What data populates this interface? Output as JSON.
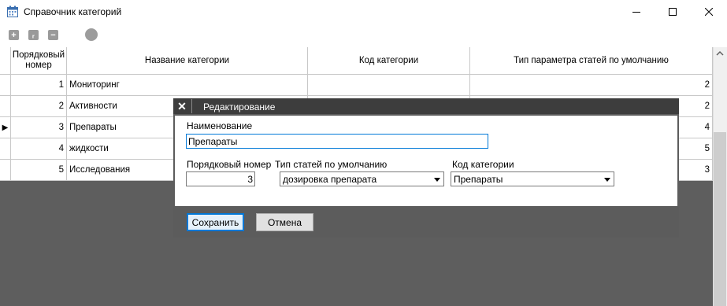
{
  "window": {
    "title": "Справочник категорий",
    "icon": "calendar-grid-icon",
    "minimize_glyph": "—",
    "maximize_glyph": "☐",
    "close_glyph": "✕"
  },
  "toolbar": {
    "add_glyph": "+",
    "edit_glyph": "ᵣ",
    "remove_glyph": "−"
  },
  "table": {
    "headers": [
      "Порядковый номер",
      "Название категории",
      "Код категории",
      "Тип параметра статей по умолчанию"
    ],
    "rows": [
      {
        "num": "1",
        "name": "Мониторинг",
        "code": "",
        "type": "2"
      },
      {
        "num": "2",
        "name": "Активности",
        "code": "",
        "type": "2"
      },
      {
        "num": "3",
        "name": "Препараты",
        "code": "",
        "type": "4"
      },
      {
        "num": "4",
        "name": "жидкости",
        "code": "",
        "type": "5"
      },
      {
        "num": "5",
        "name": "Исследования",
        "code": "",
        "type": "3"
      }
    ],
    "current_row_marker": "▶"
  },
  "dialog": {
    "title": "Редактирование",
    "close_glyph": "✕",
    "name_label": "Наименование",
    "name_value": "Препараты",
    "order_label": "Порядковый номер",
    "order_value": "3",
    "type_label": "Тип статей по умолчанию",
    "type_value": "дозировка препарата",
    "code_label": "Код категории",
    "code_value": "Препараты",
    "save_label": "Сохранить",
    "cancel_label": "Отмена"
  },
  "colors": {
    "accent": "#0078d7",
    "dialog_title_bg": "#3d3d3d",
    "backdrop": "#5e5e5e"
  }
}
